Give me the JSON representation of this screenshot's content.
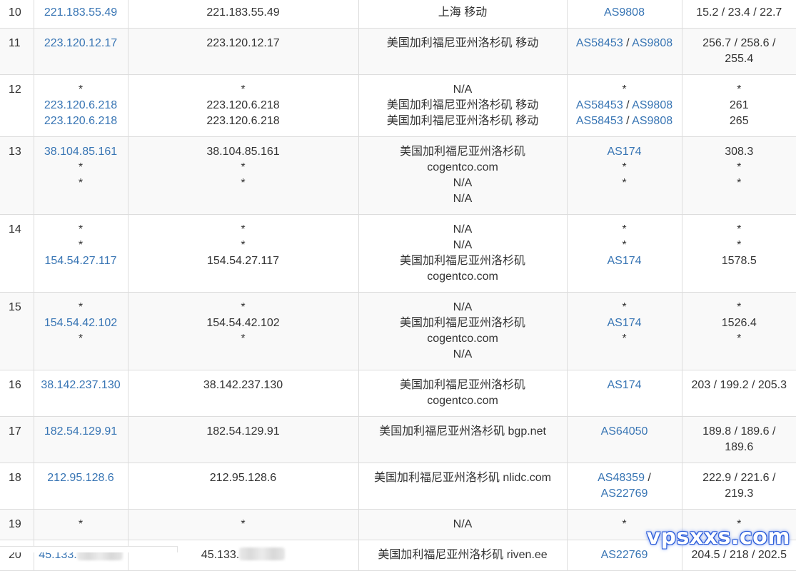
{
  "watermark": "vpsxxs.com",
  "colors": {
    "link": "#3875b4",
    "text": "#333333",
    "border": "#dddddd",
    "alt_row": "#f9f9f9"
  },
  "rows": [
    {
      "hop": "10",
      "ips": [
        "221.183.55.49"
      ],
      "hosts": [
        "221.183.55.49"
      ],
      "locs": [
        "上海 移动"
      ],
      "as": [
        [
          "AS9808"
        ]
      ],
      "rtt": [
        "15.2 / 23.4 / 22.7"
      ]
    },
    {
      "hop": "11",
      "ips": [
        "223.120.12.17"
      ],
      "hosts": [
        "223.120.12.17"
      ],
      "locs": [
        "美国加利福尼亚州洛杉矶 移动"
      ],
      "as": [
        [
          "AS58453",
          "AS9808"
        ]
      ],
      "rtt": [
        "256.7 / 258.6 /",
        "255.4"
      ]
    },
    {
      "hop": "12",
      "ips": [
        "*",
        "223.120.6.218",
        "223.120.6.218"
      ],
      "hosts": [
        "*",
        "223.120.6.218",
        "223.120.6.218"
      ],
      "locs": [
        "N/A",
        "美国加利福尼亚州洛杉矶 移动",
        "美国加利福尼亚州洛杉矶 移动"
      ],
      "as": [
        [
          "*"
        ],
        [
          "AS58453",
          "AS9808"
        ],
        [
          "AS58453",
          "AS9808"
        ]
      ],
      "rtt": [
        "*",
        "261",
        "265"
      ]
    },
    {
      "hop": "13",
      "ips": [
        "38.104.85.161",
        "*",
        "*"
      ],
      "hosts": [
        "38.104.85.161",
        "*",
        "*"
      ],
      "locs": [
        "美国加利福尼亚州洛杉矶",
        "cogentco.com",
        "N/A",
        "N/A"
      ],
      "as": [
        [
          "AS174"
        ],
        [
          "*"
        ],
        [
          "*"
        ]
      ],
      "rtt": [
        "308.3",
        "*",
        "*"
      ]
    },
    {
      "hop": "14",
      "ips": [
        "*",
        "*",
        "154.54.27.117"
      ],
      "hosts": [
        "*",
        "*",
        "154.54.27.117"
      ],
      "locs": [
        "N/A",
        "N/A",
        "美国加利福尼亚州洛杉矶",
        "cogentco.com"
      ],
      "as": [
        [
          "*"
        ],
        [
          "*"
        ],
        [
          "AS174"
        ]
      ],
      "rtt": [
        "*",
        "*",
        "1578.5"
      ]
    },
    {
      "hop": "15",
      "ips": [
        "*",
        "154.54.42.102",
        "*"
      ],
      "hosts": [
        "*",
        "154.54.42.102",
        "*"
      ],
      "locs": [
        "N/A",
        "美国加利福尼亚州洛杉矶",
        "cogentco.com",
        "N/A"
      ],
      "as": [
        [
          "*"
        ],
        [
          "AS174"
        ],
        [
          "*"
        ]
      ],
      "rtt": [
        "*",
        "1526.4",
        "*"
      ]
    },
    {
      "hop": "16",
      "ips": [
        "38.142.237.130"
      ],
      "hosts": [
        "38.142.237.130"
      ],
      "locs": [
        "美国加利福尼亚州洛杉矶",
        "cogentco.com"
      ],
      "as": [
        [
          "AS174"
        ]
      ],
      "rtt": [
        "203 / 199.2 / 205.3"
      ]
    },
    {
      "hop": "17",
      "ips": [
        "182.54.129.91"
      ],
      "hosts": [
        "182.54.129.91"
      ],
      "locs": [
        "美国加利福尼亚州洛杉矶 bgp.net"
      ],
      "as": [
        [
          "AS64050"
        ]
      ],
      "rtt": [
        "189.8 / 189.6 /",
        "189.6"
      ]
    },
    {
      "hop": "18",
      "ips": [
        "212.95.128.6"
      ],
      "hosts": [
        "212.95.128.6"
      ],
      "locs": [
        "美国加利福尼亚州洛杉矶 nlidc.com"
      ],
      "as": [
        [
          "AS48359",
          "AS22769"
        ]
      ],
      "rtt": [
        "222.9 / 221.6 /",
        "219.3"
      ]
    },
    {
      "hop": "19",
      "ips": [
        "*"
      ],
      "hosts": [
        "*"
      ],
      "locs": [
        "N/A"
      ],
      "as": [
        [
          "*"
        ]
      ],
      "rtt": [
        "*"
      ]
    },
    {
      "hop": "20",
      "ips": [
        "45.133."
      ],
      "hosts": [
        "45.133."
      ],
      "locs": [
        "美国加利福尼亚州洛杉矶 riven.ee"
      ],
      "as": [
        [
          "AS22769"
        ]
      ],
      "rtt": [
        "204.5 / 218 / 202.5"
      ],
      "blurred": true
    }
  ]
}
